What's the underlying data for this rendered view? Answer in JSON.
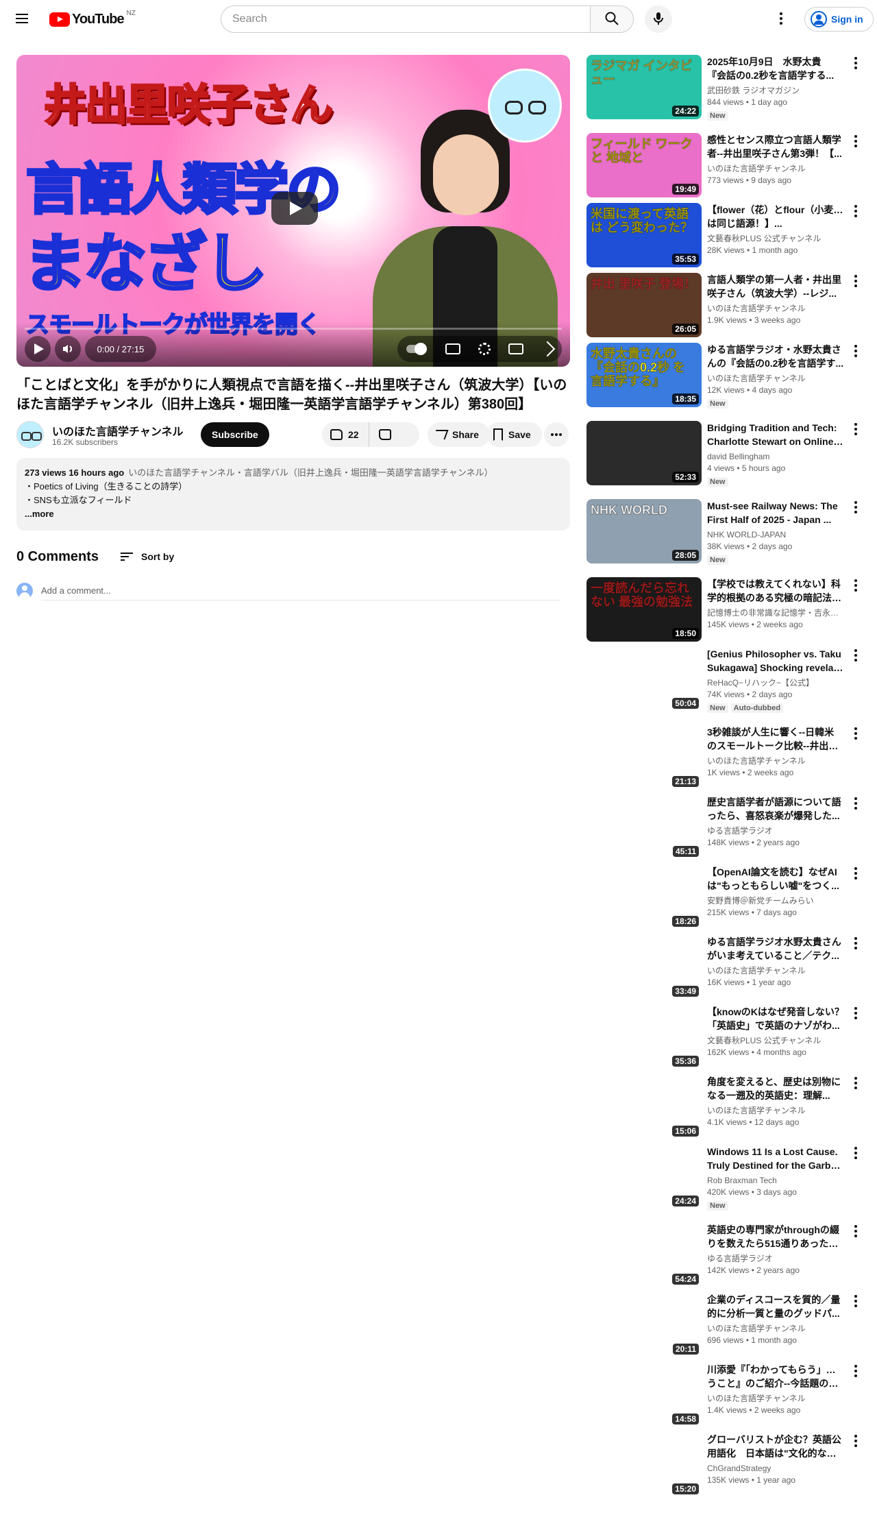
{
  "header": {
    "logo_text": "YouTube",
    "country_code": "NZ",
    "search_placeholder": "Search",
    "signin_label": "Sign in"
  },
  "player": {
    "thumb_line1": "井出里咲子さん",
    "thumb_line2": "言語人類学の",
    "thumb_line3": "まなざし",
    "thumb_band": "スモールトークが世界を開く",
    "time": "0:00 / 27:15",
    "progress": 0
  },
  "video": {
    "title": "「ことばと文化」を手がかりに人類視点で言語を描く--井出里咲子さん（筑波大学）【いのほた言語学チャンネル（旧井上逸兵・堀田隆一英語学言語学チャンネル）第380回】",
    "channel": "いのほた言語学チャンネル",
    "subscribers": "16.2K subscribers",
    "subscribe_label": "Subscribe",
    "likes": "22",
    "share_label": "Share",
    "save_label": "Save"
  },
  "description": {
    "stats": "273 views  16 hours ago",
    "tags": "いのほた言語学チャンネル・言語学バル（旧井上逸兵・堀田隆一英語学言語学チャンネル）",
    "line1": "・Poetics of Living（生きることの詩学）",
    "line2": "・SNSも立派なフィールド",
    "more": "...more"
  },
  "comments": {
    "count": "0 Comments",
    "sort_label": "Sort by",
    "placeholder": "Add a comment..."
  },
  "recommendations": [
    {
      "l1": "2025年10月9日　水野太貴",
      "l2": "『会話の0.2秒を言語学する...",
      "channel": "武田砂鉄 ラジオマガジン",
      "meta": "844 views • 1 day ago",
      "duration": "24:22",
      "badges": [
        "New"
      ],
      "thumb": "ラジマガ インタビュー",
      "bg": "#27c2a8",
      "fg": "#fff45c"
    },
    {
      "l1": "感性とセンス際立つ言語人類学",
      "l2": "者--井出里咲子さん第3弾！【...",
      "channel": "いのほた言語学チャンネル",
      "meta": "773 views • 9 days ago",
      "duration": "19:49",
      "badges": [],
      "thumb": "フィールド ワークと 地域と",
      "bg": "#e96fc8",
      "fg": "#fff200"
    },
    {
      "l1": "【flower（花）とflour（小麦粉）",
      "l2": "は同じ語源！】...",
      "channel": "文藝春秋PLUS 公式チャンネル",
      "meta": "28K views • 1 month ago",
      "duration": "35:53",
      "badges": [],
      "thumb": "米国に渡って英語は どう変わった？",
      "bg": "#1e4fd6",
      "fg": "#fff200"
    },
    {
      "l1": "言語人類学の第一人者・井出里",
      "l2": "咲子さん（筑波大学）--レジ...",
      "channel": "いのほた言語学チャンネル",
      "meta": "1.9K views • 3 weeks ago",
      "duration": "26:05",
      "badges": [],
      "thumb": "井出 里咲子 登場！",
      "bg": "#5d3a28",
      "fg": "#ff3b3b"
    },
    {
      "l1": "ゆる言語学ラジオ・水野太貴さ",
      "l2": "んの『会話の0.2秒を言語学す...",
      "channel": "いのほた言語学チャンネル",
      "meta": "12K views • 4 days ago",
      "duration": "18:35",
      "badges": [
        "New"
      ],
      "thumb": "水野太貴さんの 『会話の0.2秒 を言語学する』",
      "bg": "#3a7be0",
      "fg": "#fff200"
    },
    {
      "l1": "Bridging Tradition and Tech:",
      "l2": "Charlotte Stewart on Online Ar...",
      "channel": "david Bellingham",
      "meta": "4 views • 5 hours ago",
      "duration": "52:33",
      "badges": [
        "New"
      ],
      "thumb": "",
      "bg": "#2b2b2b",
      "fg": "#fff"
    },
    {
      "l1": "Must-see Railway News: The",
      "l2": "First Half of 2025 - Japan ...",
      "channel": "NHK WORLD-JAPAN",
      "meta": "38K views • 2 days ago",
      "duration": "28:05",
      "badges": [
        "New"
      ],
      "thumb": "NHK WORLD",
      "bg": "#8fa0b0",
      "fg": "#fff"
    },
    {
      "l1": "【学校では教えてくれない】科",
      "l2": "学的根拠のある究極の暗記法5...",
      "channel": "記憶博士の非常識な記憶学・吉永先生",
      "meta": "145K views • 2 weeks ago",
      "duration": "18:50",
      "badges": [],
      "thumb": "一度読んだら忘れない 最強の勉強法",
      "bg": "#1b1b1b",
      "fg": "#ff2a2a"
    },
    {
      "l1": "[Genius Philosopher vs. Taku",
      "l2": "Sukagawa] Shocking revelatio...",
      "channel": "ReHacQ−リハック−【公式】",
      "meta": "74K views • 2 days ago",
      "duration": "50:04",
      "badges": [
        "New",
        "Auto-dubbed"
      ],
      "thumb": "",
      "bg": "",
      "fg": ""
    },
    {
      "l1": "3秒雑談が人生に響く--日韓米",
      "l2": "のスモールトーク比較--井出里...",
      "channel": "いのほた言語学チャンネル",
      "meta": "1K views • 2 weeks ago",
      "duration": "21:13",
      "badges": [],
      "thumb": "",
      "bg": "",
      "fg": ""
    },
    {
      "l1": "歴史言語学者が語源について語",
      "l2": "ったら、喜怒哀楽が爆発した...",
      "channel": "ゆる言語学ラジオ",
      "meta": "148K views • 2 years ago",
      "duration": "45:11",
      "badges": [],
      "thumb": "",
      "bg": "",
      "fg": ""
    },
    {
      "l1": "【OpenAI論文を読む】なぜAI",
      "l2": "は\"もっともらしい嘘\"をつく...",
      "channel": "安野貴博＠新党チームみらい",
      "meta": "215K views • 7 days ago",
      "duration": "18:26",
      "badges": [],
      "thumb": "",
      "bg": "",
      "fg": ""
    },
    {
      "l1": "ゆる言語学ラジオ水野太貴さん",
      "l2": "がいま考えていること／テク...",
      "channel": "いのほた言語学チャンネル",
      "meta": "16K views • 1 year ago",
      "duration": "33:49",
      "badges": [],
      "thumb": "",
      "bg": "",
      "fg": ""
    },
    {
      "l1": "【knowのKはなぜ発音しない？",
      "l2": "「英語史」で英語のナゾがわ...",
      "channel": "文藝春秋PLUS 公式チャンネル",
      "meta": "162K views • 4 months ago",
      "duration": "35:36",
      "badges": [],
      "thumb": "",
      "bg": "",
      "fg": ""
    },
    {
      "l1": "角度を変えると、歴史は別物に",
      "l2": "なる一遡及的英語史：理解...",
      "channel": "いのほた言語学チャンネル",
      "meta": "4.1K views • 12 days ago",
      "duration": "15:06",
      "badges": [],
      "thumb": "",
      "bg": "",
      "fg": ""
    },
    {
      "l1": "Windows 11 Is a Lost Cause.",
      "l2": "Truly Destined for the Garbage...",
      "channel": "Rob Braxman Tech",
      "meta": "420K views • 3 days ago",
      "duration": "24:24",
      "badges": [
        "New"
      ],
      "thumb": "",
      "bg": "",
      "fg": ""
    },
    {
      "l1": "英語史の専門家がthroughの綴",
      "l2": "りを数えたら515通りあった話...",
      "channel": "ゆる言語学ラジオ",
      "meta": "142K views • 2 years ago",
      "duration": "54:24",
      "badges": [],
      "thumb": "",
      "bg": "",
      "fg": ""
    },
    {
      "l1": "企業のディスコースを質的／量",
      "l2": "的に分析一質と量のグッドパ...",
      "channel": "いのほた言語学チャンネル",
      "meta": "696 views • 1 month ago",
      "duration": "20:11",
      "badges": [],
      "thumb": "",
      "bg": "",
      "fg": ""
    },
    {
      "l1": "川添愛『「わかってもらう」とい",
      "l2": "うこと』のご紹介--今話題の川...",
      "channel": "いのほた言語学チャンネル",
      "meta": "1.4K views • 2 weeks ago",
      "duration": "14:58",
      "badges": [],
      "thumb": "",
      "bg": "",
      "fg": ""
    },
    {
      "l1": "グローバリストが企む？英語公",
      "l2": "用語化　日本語は\"文化的なパ...",
      "channel": "ChGrandStrategy",
      "meta": "135K views • 1 year ago",
      "duration": "15:20",
      "badges": [],
      "thumb": "",
      "bg": "",
      "fg": ""
    }
  ]
}
